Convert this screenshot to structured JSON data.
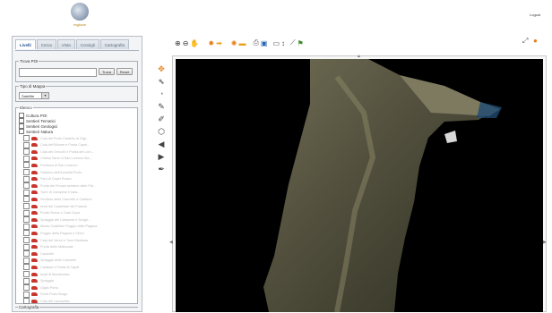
{
  "header": {
    "logo_text": "regione",
    "login_label": "Logout"
  },
  "sidebar": {
    "tabs": [
      {
        "label": "Livelli"
      },
      {
        "label": "Cerca"
      },
      {
        "label": "Vista"
      },
      {
        "label": "Consigli"
      },
      {
        "label": "Cartografia"
      }
    ],
    "trova": {
      "legend": "Trova POI",
      "input_value": "",
      "find_label": "Trova",
      "reset_label": "Reset"
    },
    "tipo": {
      "legend": "Tipo di Mappa",
      "selected": "Satellite"
    },
    "elenco": {
      "legend": "Elenco",
      "groups": [
        {
          "label": "Cultura POI"
        },
        {
          "label": "Sentieri Tematici"
        },
        {
          "label": "Sentieri Geologici"
        },
        {
          "label": "Sentieri Natura"
        }
      ],
      "items": [
        {
          "label": "Cala del Porto Castello di Gigl..."
        },
        {
          "label": "Cala dell'Allume e Punta Capel..."
        },
        {
          "label": "Cala dei Grecchi e Punta del Lion..."
        },
        {
          "label": "Chiesa Santi di San Lorenzo Ala..."
        },
        {
          "label": "Fortezza di San Lorenzo"
        },
        {
          "label": "Giardino dell'Arenella Porto"
        },
        {
          "label": "Faro di Capel Rosso"
        },
        {
          "label": "Punta del Fenaio sentiero delle Pal..."
        },
        {
          "label": "Torre di Campese e baia..."
        },
        {
          "label": "Sentiero delle Cannelle e Caldane"
        },
        {
          "label": "Area del Castellare dei Franchi"
        },
        {
          "label": "Punta Secca e Cala Cupa"
        },
        {
          "label": "Spiaggia del Campese e Scogli..."
        },
        {
          "label": "Monte Castellari Poggio della Pagana"
        },
        {
          "label": "Poggio della Pagana e Serra"
        },
        {
          "label": "Cala dei Ventri e Torre Medicea"
        },
        {
          "label": "Punta delle Mattonaie"
        },
        {
          "label": "Cannelle"
        },
        {
          "label": "Spiaggia delle Cannelle"
        },
        {
          "label": "Caldane e Punta di Capel"
        },
        {
          "label": "Isola di Montecristo"
        },
        {
          "label": "Spiaggia"
        },
        {
          "label": "Giglio Porto"
        },
        {
          "label": "Porto Porto Borgo"
        },
        {
          "label": "Cala del Lazzaretto"
        }
      ]
    },
    "cartografia_legend": "Cartografia"
  },
  "map": {
    "colors": {
      "background": "#000000",
      "land_dark": "#3a3a2a",
      "land_light": "#7d7a60",
      "sea_bright": "#1e4a70"
    }
  }
}
